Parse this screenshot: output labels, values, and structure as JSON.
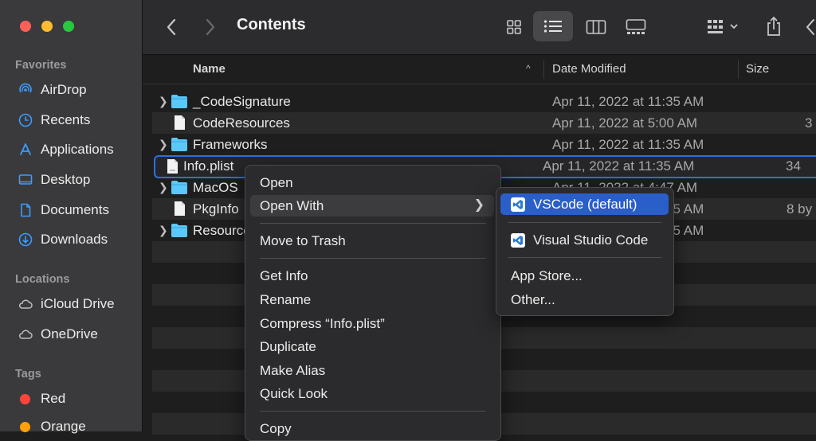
{
  "window": {
    "title": "Contents"
  },
  "sidebar": {
    "favorites_header": "Favorites",
    "favorites": [
      {
        "label": "AirDrop",
        "icon": "airdrop-icon"
      },
      {
        "label": "Recents",
        "icon": "clock-icon"
      },
      {
        "label": "Applications",
        "icon": "applications-icon"
      },
      {
        "label": "Desktop",
        "icon": "desktop-icon"
      },
      {
        "label": "Documents",
        "icon": "document-icon"
      },
      {
        "label": "Downloads",
        "icon": "download-icon"
      }
    ],
    "locations_header": "Locations",
    "locations": [
      {
        "label": "iCloud Drive",
        "icon": "cloud-icon"
      },
      {
        "label": "OneDrive",
        "icon": "cloud-icon"
      }
    ],
    "tags_header": "Tags",
    "tags": [
      {
        "label": "Red",
        "color": "#ff453a"
      },
      {
        "label": "Orange",
        "color": "#ff9f0a"
      }
    ]
  },
  "columns": {
    "name": "Name",
    "date": "Date Modified",
    "size": "Size"
  },
  "files": [
    {
      "name": "_CodeSignature",
      "date": "Apr 11, 2022 at 11:35 AM",
      "size": "",
      "type": "folder"
    },
    {
      "name": "CodeResources",
      "date": "Apr 11, 2022 at 5:00 AM",
      "size": "3",
      "type": "file"
    },
    {
      "name": "Frameworks",
      "date": "Apr 11, 2022 at 11:35 AM",
      "size": "",
      "type": "folder"
    },
    {
      "name": "Info.plist",
      "date": "Apr 11, 2022 at 11:35 AM",
      "size": "34",
      "type": "plist"
    },
    {
      "name": "MacOS",
      "date": "Apr 11, 2022 at 4:47 AM",
      "size": "",
      "type": "folder"
    },
    {
      "name": "PkgInfo",
      "date": "Apr 11, 2022 at 11:35 AM",
      "size": "8 by",
      "type": "file"
    },
    {
      "name": "Resources",
      "date": "Apr 11, 2022 at 11:35 AM",
      "size": "",
      "type": "folder"
    }
  ],
  "context_menu": {
    "open": "Open",
    "open_with": "Open With",
    "move_to_trash": "Move to Trash",
    "get_info": "Get Info",
    "rename": "Rename",
    "compress": "Compress “Info.plist”",
    "duplicate": "Duplicate",
    "make_alias": "Make Alias",
    "quick_look": "Quick Look",
    "copy": "Copy"
  },
  "submenu": {
    "vscode_default": "VSCode (default)",
    "visual_studio_code": "Visual Studio Code",
    "app_store": "App Store...",
    "other": "Other..."
  },
  "colors": {
    "accent": "#2a5ec9",
    "folder": "#5ac8fa",
    "selection_outline": "#2f6fe0"
  }
}
